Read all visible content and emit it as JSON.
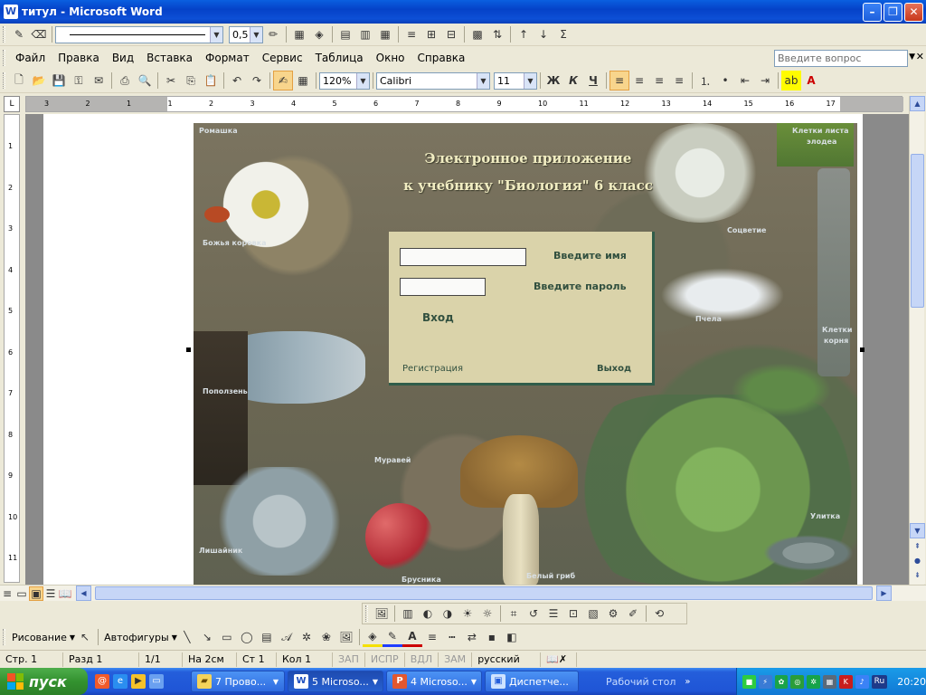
{
  "window": {
    "title": "титул - Microsoft Word",
    "app_icon": "W"
  },
  "drawing_toolbar_top": {
    "line_weight_value": "0,5"
  },
  "menu": {
    "items": [
      "Файл",
      "Правка",
      "Вид",
      "Вставка",
      "Формат",
      "Сервис",
      "Таблица",
      "Окно",
      "Справка"
    ],
    "ask_placeholder": "Введите вопрос"
  },
  "format_toolbar": {
    "zoom": "120%",
    "font_name": "Calibri",
    "font_size": "11",
    "bold": "Ж",
    "italic": "К",
    "underline": "Ч"
  },
  "ruler": {
    "h_numbers": [
      "3",
      "2",
      "1",
      "1",
      "2",
      "3",
      "4",
      "5",
      "6",
      "7",
      "8",
      "9",
      "10",
      "11",
      "12",
      "13",
      "14",
      "15",
      "16",
      "17"
    ],
    "v_numbers": [
      "1",
      "2",
      "3",
      "4",
      "5",
      "6",
      "7",
      "8",
      "9",
      "10",
      "11"
    ],
    "corner": "L"
  },
  "document": {
    "headline_line1": "Электронное приложение",
    "headline_line2": "к учебнику \"Биология\" 6 класс",
    "scene_labels": {
      "romashka": "Ромашка",
      "kletki_lista": "Клетки листа",
      "elodea": "элодеа",
      "bozhya_korovka": "Божья коровка",
      "socvetie": "Соцветие",
      "pchela": "Пчела",
      "kletki_kornya": "Клетки",
      "korny": "корня",
      "popolzen": "Поползень",
      "muravey": "Муравей",
      "ulitka": "Улитка",
      "lishaynik": "Лишайник",
      "brusnika": "Брусника",
      "bely_grib": "Белый гриб"
    },
    "login": {
      "name_label": "Введите имя",
      "password_label": "Введите пароль",
      "name_value": "",
      "password_value": "",
      "enter_button": "Вход",
      "register_link": "Регистрация",
      "exit_link": "Выход"
    }
  },
  "bottom_toolbar": {
    "drawing_menu": "Рисование",
    "autoshapes_menu": "Автофигуры"
  },
  "status": {
    "page": "Стр.  1",
    "section": "Разд  1",
    "pages": "1/1",
    "at": "На  2см",
    "line": "Ст  1",
    "col": "Кол  1",
    "rec": "ЗАП",
    "trk": "ИСПР",
    "ext": "ВДЛ",
    "ovr": "ЗАМ",
    "language": "русский (Ро"
  },
  "taskbar": {
    "start_label": "пуск",
    "buttons": [
      {
        "label": "7 Прово...",
        "icon": "folder-icon"
      },
      {
        "label": "5 Microso...",
        "icon": "word-icon"
      },
      {
        "label": "4 Microso...",
        "icon": "powerpoint-icon"
      },
      {
        "label": "Диспетче...",
        "icon": "monitor-icon"
      }
    ],
    "desktop_label": "Рабочий стол",
    "language": "Ru",
    "clock": "20:20"
  },
  "colors": {
    "titlebar": "#0a4fd6",
    "taskbar": "#245edb",
    "start": "#33922f",
    "login_panel": "#ded7ad",
    "login_text": "#30503f",
    "headline": "#f1edc2"
  }
}
